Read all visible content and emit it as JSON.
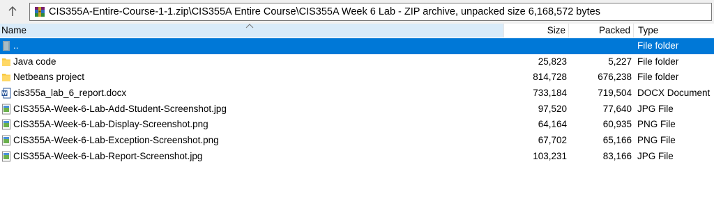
{
  "address": {
    "path": "CIS355A-Entire-Course-1-1.zip\\CIS355A Entire Course\\CIS355A Week 6 Lab - ZIP archive, unpacked size 6,168,572 bytes"
  },
  "columns": {
    "name": "Name",
    "size": "Size",
    "packed": "Packed",
    "type": "Type"
  },
  "files": [
    {
      "name": "..",
      "size": "",
      "packed": "",
      "type": "File folder",
      "icon": "parent-folder-icon",
      "selected": true
    },
    {
      "name": "Java code",
      "size": "25,823",
      "packed": "5,227",
      "type": "File folder",
      "icon": "folder-icon"
    },
    {
      "name": "Netbeans project",
      "size": "814,728",
      "packed": "676,238",
      "type": "File folder",
      "icon": "folder-icon"
    },
    {
      "name": "cis355a_lab_6_report.docx",
      "size": "733,184",
      "packed": "719,504",
      "type": "DOCX Document",
      "icon": "word-document-icon"
    },
    {
      "name": "CIS355A-Week-6-Lab-Add-Student-Screenshot.jpg",
      "size": "97,520",
      "packed": "77,640",
      "type": "JPG File",
      "icon": "image-file-icon"
    },
    {
      "name": "CIS355A-Week-6-Lab-Display-Screenshot.png",
      "size": "64,164",
      "packed": "60,935",
      "type": "PNG File",
      "icon": "image-file-icon"
    },
    {
      "name": "CIS355A-Week-6-Lab-Exception-Screenshot.png",
      "size": "67,702",
      "packed": "65,166",
      "type": "PNG File",
      "icon": "image-file-icon"
    },
    {
      "name": "CIS355A-Week-6-Lab-Report-Screenshot.jpg",
      "size": "103,231",
      "packed": "83,166",
      "type": "JPG File",
      "icon": "image-file-icon"
    }
  ],
  "colors": {
    "selection": "#0078d7",
    "header_highlight": "#d9ebf9",
    "folder": "#f8c840"
  }
}
